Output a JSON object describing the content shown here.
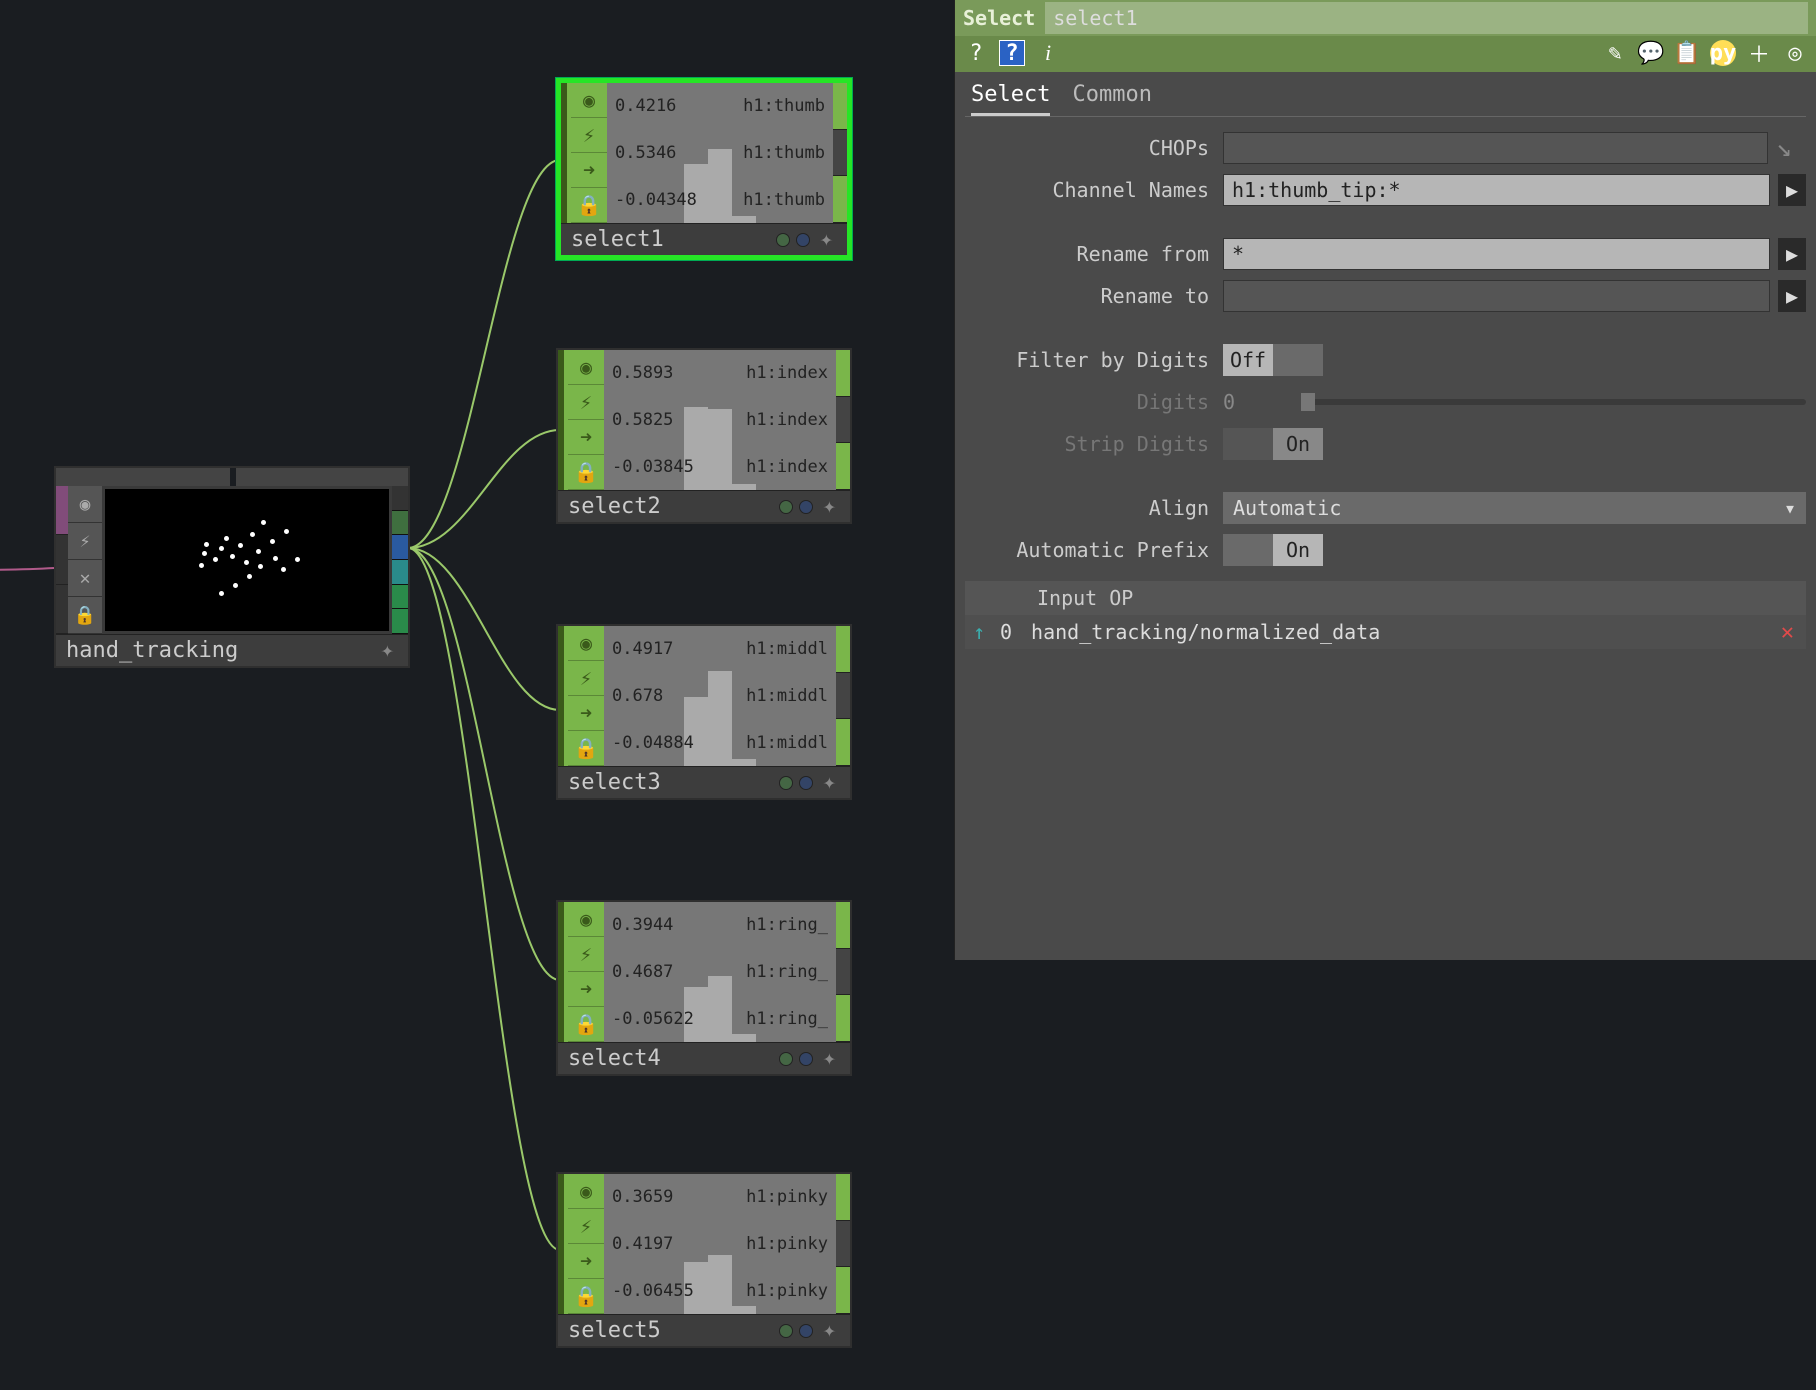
{
  "source_node": {
    "name": "hand_tracking"
  },
  "nodes": [
    {
      "name": "select1",
      "selected": true,
      "rows": [
        {
          "value": "0.4216",
          "label": "h1:thumb"
        },
        {
          "value": "0.5346",
          "label": "h1:thumb"
        },
        {
          "value": "-0.04348",
          "label": "h1:thumb"
        }
      ]
    },
    {
      "name": "select2",
      "selected": false,
      "rows": [
        {
          "value": "0.5893",
          "label": "h1:index"
        },
        {
          "value": "0.5825",
          "label": "h1:index"
        },
        {
          "value": "-0.03845",
          "label": "h1:index"
        }
      ]
    },
    {
      "name": "select3",
      "selected": false,
      "rows": [
        {
          "value": "0.4917",
          "label": "h1:middl"
        },
        {
          "value": "0.678",
          "label": "h1:middl"
        },
        {
          "value": "-0.04884",
          "label": "h1:middl"
        }
      ]
    },
    {
      "name": "select4",
      "selected": false,
      "rows": [
        {
          "value": "0.3944",
          "label": "h1:ring_"
        },
        {
          "value": "0.4687",
          "label": "h1:ring_"
        },
        {
          "value": "-0.05622",
          "label": "h1:ring_"
        }
      ]
    },
    {
      "name": "select5",
      "selected": false,
      "rows": [
        {
          "value": "0.3659",
          "label": "h1:pinky"
        },
        {
          "value": "0.4197",
          "label": "h1:pinky"
        },
        {
          "value": "-0.06455",
          "label": "h1:pinky"
        }
      ]
    }
  ],
  "panel": {
    "type": "Select",
    "name": "select1",
    "tabs": [
      "Select",
      "Common"
    ],
    "active_tab": "Select",
    "params": {
      "chops_label": "CHOPs",
      "chops_value": "",
      "channames_label": "Channel Names",
      "channames_value": "h1:thumb_tip:*",
      "renfrom_label": "Rename from",
      "renfrom_value": "*",
      "rento_label": "Rename to",
      "rento_value": "",
      "filterdigits_label": "Filter by Digits",
      "filterdigits_value": "Off",
      "digits_label": "Digits",
      "digits_value": "0",
      "stripdigits_label": "Strip Digits",
      "stripdigits_value": "On",
      "align_label": "Align",
      "align_value": "Automatic",
      "autoprefix_label": "Automatic Prefix",
      "autoprefix_value": "On"
    },
    "input_op": {
      "header": "Input OP",
      "index": "0",
      "path": "hand_tracking/normalized_data"
    }
  }
}
